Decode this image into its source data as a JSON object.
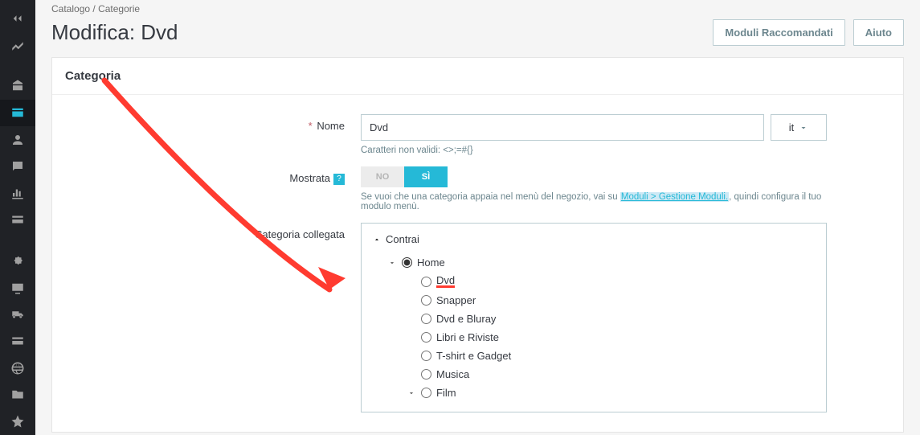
{
  "breadcrumb": {
    "parent": "Catalogo",
    "current": "Categorie"
  },
  "page_title": "Modifica: Dvd",
  "header_buttons": {
    "recommended": "Moduli Raccomandati",
    "help": "Aiuto"
  },
  "panel_title": "Categoria",
  "form": {
    "name_label": "Nome",
    "name_value": "Dvd",
    "name_help": "Caratteri non validi: <>;=#{}",
    "lang": "it",
    "shown_label": "Mostrata",
    "toggle_no": "NO",
    "toggle_yes": "SÌ",
    "shown_help_pre": "Se vuoi che una categoria appaia nel menù del negozio, vai su ",
    "shown_help_link": "Moduli > Gestione Moduli.",
    "shown_help_post": ", quindi configura il tuo modulo menù.",
    "parent_label": "Categoria collegata"
  },
  "tree": {
    "collapse": "Contrai",
    "root": "Home",
    "children": [
      {
        "label": "Dvd",
        "highlight": true
      },
      {
        "label": "Snapper"
      },
      {
        "label": "Dvd e Bluray"
      },
      {
        "label": "Libri e Riviste"
      },
      {
        "label": "T-shirt e Gadget"
      },
      {
        "label": "Musica"
      },
      {
        "label": "Film",
        "expandable": true
      }
    ]
  }
}
